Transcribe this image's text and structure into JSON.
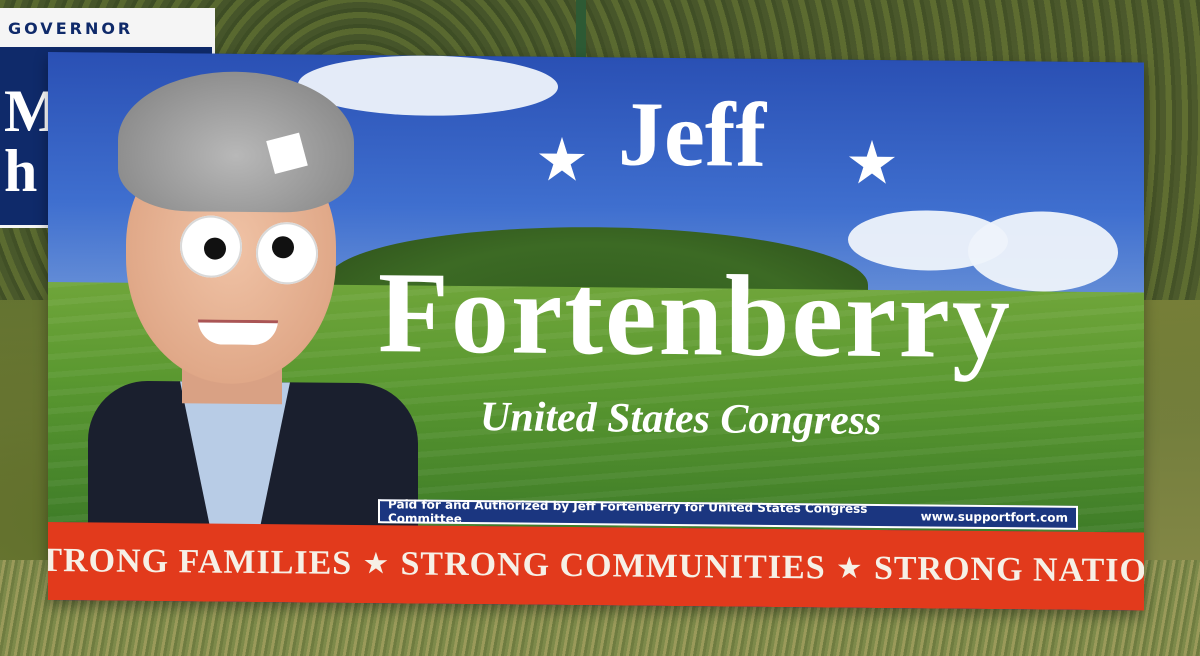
{
  "background_sign": {
    "header": "GOVERNOR",
    "letters": [
      "M",
      "h"
    ]
  },
  "sign": {
    "first_name": "Jeff",
    "last_name": "Fortenberry",
    "office": "United States Congress",
    "disclaimer": "Paid for and Authorized by Jeff Fortenberry for United States Congress Committee",
    "website": "www.supportfort.com",
    "slogan": [
      "STRONG  FAMILIES",
      "STRONG  COMMUNITIES",
      "STRONG  NATION"
    ],
    "colors": {
      "sign_blue": "#1b3a8a",
      "slogan_red": "#e23a1c",
      "text_white": "#ffffff"
    }
  }
}
